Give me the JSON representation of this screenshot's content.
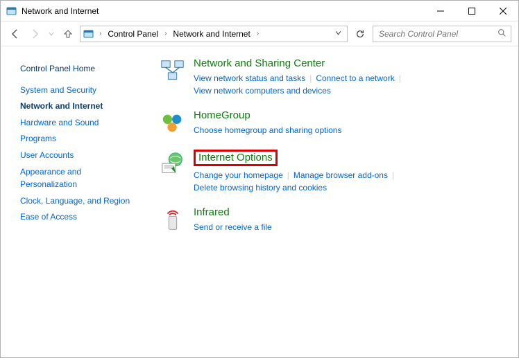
{
  "window": {
    "title": "Network and Internet"
  },
  "breadcrumb": {
    "root": "Control Panel",
    "current": "Network and Internet"
  },
  "search": {
    "placeholder": "Search Control Panel"
  },
  "sidebar": {
    "home": "Control Panel Home",
    "items": [
      {
        "label": "System and Security",
        "active": false
      },
      {
        "label": "Network and Internet",
        "active": true
      },
      {
        "label": "Hardware and Sound",
        "active": false
      },
      {
        "label": "Programs",
        "active": false
      },
      {
        "label": "User Accounts",
        "active": false
      },
      {
        "label": "Appearance and Personalization",
        "active": false
      },
      {
        "label": "Clock, Language, and Region",
        "active": false
      },
      {
        "label": "Ease of Access",
        "active": false
      }
    ]
  },
  "categories": [
    {
      "title": "Network and Sharing Center",
      "tasks": [
        "View network status and tasks",
        "Connect to a network",
        "View network computers and devices"
      ]
    },
    {
      "title": "HomeGroup",
      "tasks": [
        "Choose homegroup and sharing options"
      ]
    },
    {
      "title": "Internet Options",
      "highlighted": true,
      "tasks": [
        "Change your homepage",
        "Manage browser add-ons",
        "Delete browsing history and cookies"
      ]
    },
    {
      "title": "Infrared",
      "tasks": [
        "Send or receive a file"
      ]
    }
  ]
}
